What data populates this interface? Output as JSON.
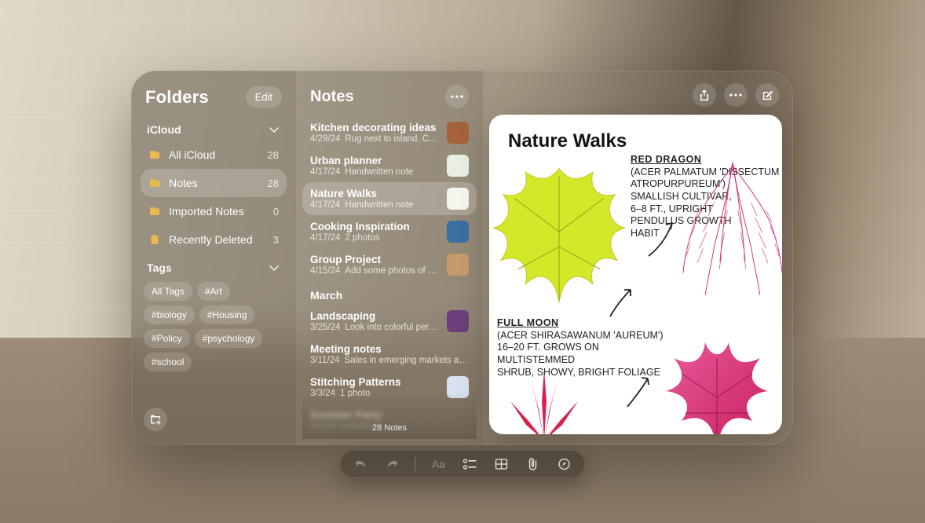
{
  "sidebar": {
    "title": "Folders",
    "edit_label": "Edit",
    "section1_label": "iCloud",
    "folders": [
      {
        "name": "All iCloud",
        "count": "28",
        "icon": "folder"
      },
      {
        "name": "Notes",
        "count": "28",
        "icon": "folder",
        "active": true
      },
      {
        "name": "Imported Notes",
        "count": "0",
        "icon": "folder"
      },
      {
        "name": "Recently Deleted",
        "count": "3",
        "icon": "trash"
      }
    ],
    "tags_label": "Tags",
    "tags": [
      "All Tags",
      "#Art",
      "#biology",
      "#Housing",
      "#Policy",
      "#psychology",
      "#school"
    ]
  },
  "notelist": {
    "title": "Notes",
    "count_label": "28 Notes",
    "month_header": "March",
    "items": [
      {
        "title": "Kitchen decorating ideas",
        "date": "4/29/24",
        "sub": "Rug next to island. Conte…",
        "thumb": "#a5613a"
      },
      {
        "title": "Urban planner",
        "date": "4/17/24",
        "sub": "Handwritten note",
        "thumb": "#e8f0e6"
      },
      {
        "title": "Nature Walks",
        "date": "4/17/24",
        "sub": "Handwritten note",
        "thumb": "#f6f6ee",
        "active": true
      },
      {
        "title": "Cooking Inspiration",
        "date": "4/17/24",
        "sub": "2 photos",
        "thumb": "#3b6ea1"
      },
      {
        "title": "Group Project",
        "date": "4/15/24",
        "sub": "Add some photos of their…",
        "thumb": "#c79a6a"
      }
    ],
    "march_items": [
      {
        "title": "Landscaping",
        "date": "3/25/24",
        "sub": "Look into colorful perenn…",
        "thumb": "#6a3f7a"
      },
      {
        "title": "Meeting notes",
        "date": "3/11/24",
        "sub": "Sales in emerging markets are tr…",
        "thumb": ""
      },
      {
        "title": "Stitching Patterns",
        "date": "3/3/24",
        "sub": "1 photo",
        "thumb": "#d9e1f0"
      },
      {
        "title": "Summer Party",
        "date": "3/1/24",
        "sub": "Invitations",
        "thumb": "",
        "blurred": true
      }
    ]
  },
  "detail": {
    "title": "Nature Walks",
    "annotations": {
      "red_dragon_title": "RED DRAGON",
      "red_dragon_body": "(ACER PALMATUM 'DISSECTUM ATROPURPUREUM')\nSMALLISH CULTIVAR,\n6–8 FT., UPRIGHT\nPENDULUS GROWTH\nHABIT",
      "full_moon_title": "FULL MOON",
      "full_moon_body": "(ACER SHIRASAWANUM 'AUREUM')\n16–20 FT. GROWS ON MULTISTEMMED\nSHRUB, SHOWY, BRIGHT FOLIAGE"
    }
  },
  "bottombar": {
    "items": [
      "undo",
      "redo",
      "sep",
      "text-style",
      "checklist",
      "table",
      "attach",
      "markup"
    ]
  }
}
